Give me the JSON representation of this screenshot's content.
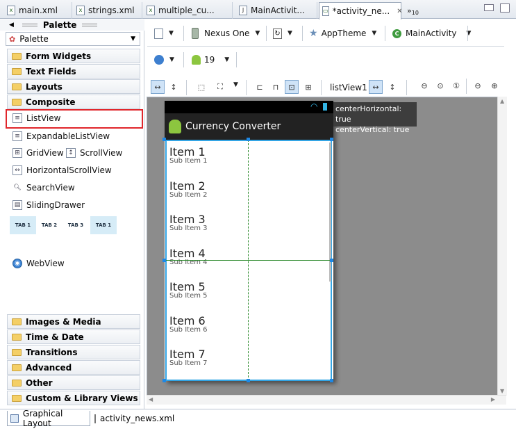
{
  "tabs": [
    {
      "label": "main.xml",
      "icon": "xml-file-icon"
    },
    {
      "label": "strings.xml",
      "icon": "xml-file-icon"
    },
    {
      "label": "multiple_cu...",
      "icon": "xml-file-icon"
    },
    {
      "label": "MainActivit...",
      "icon": "java-file-icon"
    },
    {
      "label": "*activity_ne...",
      "icon": "layout-file-icon"
    }
  ],
  "tabs_overflow": "10",
  "palette": {
    "title": "Palette",
    "combo_value": "Palette",
    "categories_top": [
      "Form Widgets",
      "Text Fields",
      "Layouts",
      "Composite"
    ],
    "composite_items": [
      "ListView",
      "ExpandableListView",
      "GridView",
      "ScrollView",
      "HorizontalScrollView",
      "SearchView",
      "SlidingDrawer",
      "WebView"
    ],
    "tab_widget_labels": [
      "TAB 1",
      "TAB 2",
      "TAB 3",
      "TAB 1"
    ],
    "categories_bottom": [
      "Images & Media",
      "Time & Date",
      "Transitions",
      "Advanced",
      "Other",
      "Custom & Library Views"
    ]
  },
  "toolbar1": {
    "device": "Nexus One",
    "theme": "AppTheme",
    "activity": "MainActivity"
  },
  "toolbar2": {
    "api_level": "19"
  },
  "toolbar3": {
    "selection_label": "listView1"
  },
  "device_screen": {
    "app_title": "Currency Converter",
    "list_items": [
      {
        "title": "Item 1",
        "sub": "Sub Item 1"
      },
      {
        "title": "Item 2",
        "sub": "Sub Item 2"
      },
      {
        "title": "Item 3",
        "sub": "Sub Item 3"
      },
      {
        "title": "Item 4",
        "sub": "Sub Item 4"
      },
      {
        "title": "Item 5",
        "sub": "Sub Item 5"
      },
      {
        "title": "Item 6",
        "sub": "Sub Item 6"
      },
      {
        "title": "Item 7",
        "sub": "Sub Item 7"
      }
    ]
  },
  "tooltip": {
    "line1": "centerHorizontal: true",
    "line2": "centerVertical: true"
  },
  "bottom_tabs": [
    "Graphical Layout",
    "activity_news.xml"
  ],
  "colors": {
    "selection_blue": "#33a5e5",
    "guide_green": "#2e8b2e",
    "highlight_red": "#e0262b"
  }
}
